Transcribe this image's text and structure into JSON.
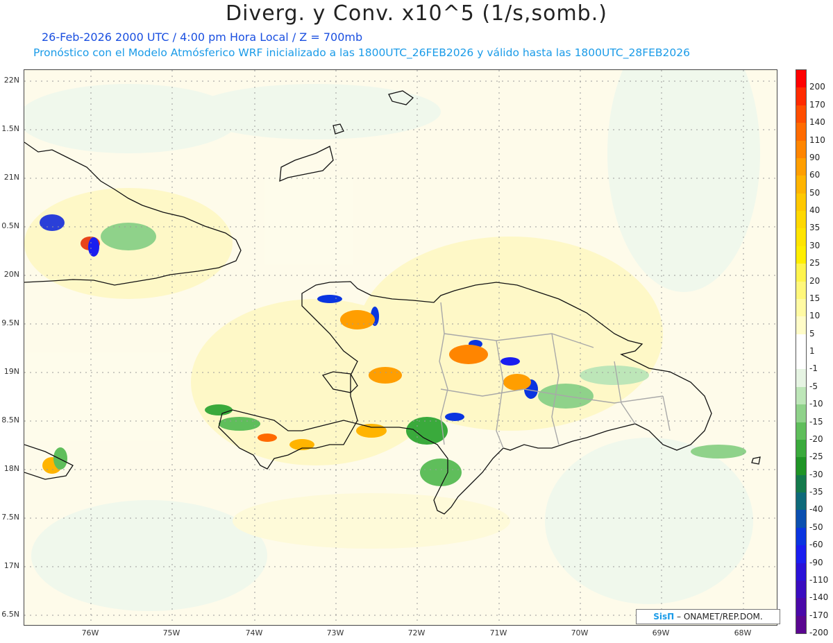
{
  "title": "Diverg. y Conv. x10^5 (1/s,somb.)",
  "subtitle_1": "26-Feb-2026  2000 UTC / 4:00 pm Hora Local / Z = 700mb",
  "subtitle_2": "Pronóstico con el Modelo Atmósferico WRF inicializado a las 1800UTC_26FEB2026 y válido hasta las  1800UTC_28FEB2026",
  "lat_labels": [
    "22N",
    "1.5N",
    "21N",
    "0.5N",
    "20N",
    "9.5N",
    "19N",
    "8.5N",
    "18N",
    "7.5N",
    "17N",
    "6.5N"
  ],
  "lon_labels": [
    "76W",
    "75W",
    "74W",
    "73W",
    "72W",
    "71W",
    "70W",
    "69W",
    "68W"
  ],
  "colorbar": {
    "labels": [
      "200",
      "170",
      "140",
      "110",
      "90",
      "60",
      "50",
      "40",
      "35",
      "30",
      "25",
      "20",
      "15",
      "10",
      "5",
      "1",
      "-1",
      "-5",
      "-10",
      "-15",
      "-20",
      "-25",
      "-30",
      "-35",
      "-40",
      "-50",
      "-60",
      "-90",
      "-110",
      "-140",
      "-170",
      "-200"
    ],
    "colors": [
      "#ff0000",
      "#ff2a00",
      "#ff4d00",
      "#ff6a00",
      "#ff8500",
      "#ff9e00",
      "#ffb400",
      "#ffc800",
      "#ffd800",
      "#ffe400",
      "#ffee00",
      "#fff44d",
      "#fff77a",
      "#fffaa3",
      "#fffcc8",
      "#ffffff",
      "#ffffff",
      "#e6f4e3",
      "#bde6b8",
      "#8fd28a",
      "#5fbe5b",
      "#3aaa3c",
      "#1f9426",
      "#147a4c",
      "#0e6a7a",
      "#0a4fb0",
      "#0a35e0",
      "#1a1ef0",
      "#2a12d8",
      "#3a0cc0",
      "#4a08a8",
      "#5a0690"
    ]
  },
  "credit": {
    "brand": "SisΠ",
    "text": " – ONAMET/REP.DOM."
  }
}
